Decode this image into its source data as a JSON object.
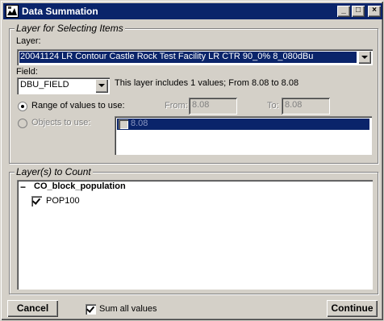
{
  "window": {
    "title": "Data Summation",
    "minimize": "_",
    "maximize": "□",
    "close": "×"
  },
  "selecting": {
    "group_title": "Layer for Selecting Items",
    "layer_label": "Layer:",
    "layer_value": "20041124 LR Contour Castle Rock Test Facility LR CTR 90_0% 8_080dBu",
    "field_label": "Field:",
    "field_value": "DBU_FIELD",
    "field_info": "This layer includes 1 values; From 8.08 to 8.08",
    "range_label": "Range of values to use:",
    "from_label": "From:",
    "from_value": "8.08",
    "to_label": "To:",
    "to_value": "8.08",
    "objects_label": "Objects to use:",
    "objects_items": [
      "8.08"
    ]
  },
  "counting": {
    "group_title": "Layer(s) to Count",
    "tree_root": "CO_block_population",
    "tree_root_expander": "−",
    "tree_child": "POP100"
  },
  "footer": {
    "cancel_label": "Cancel",
    "sum_label": "Sum all values",
    "continue_label": "Continue"
  }
}
